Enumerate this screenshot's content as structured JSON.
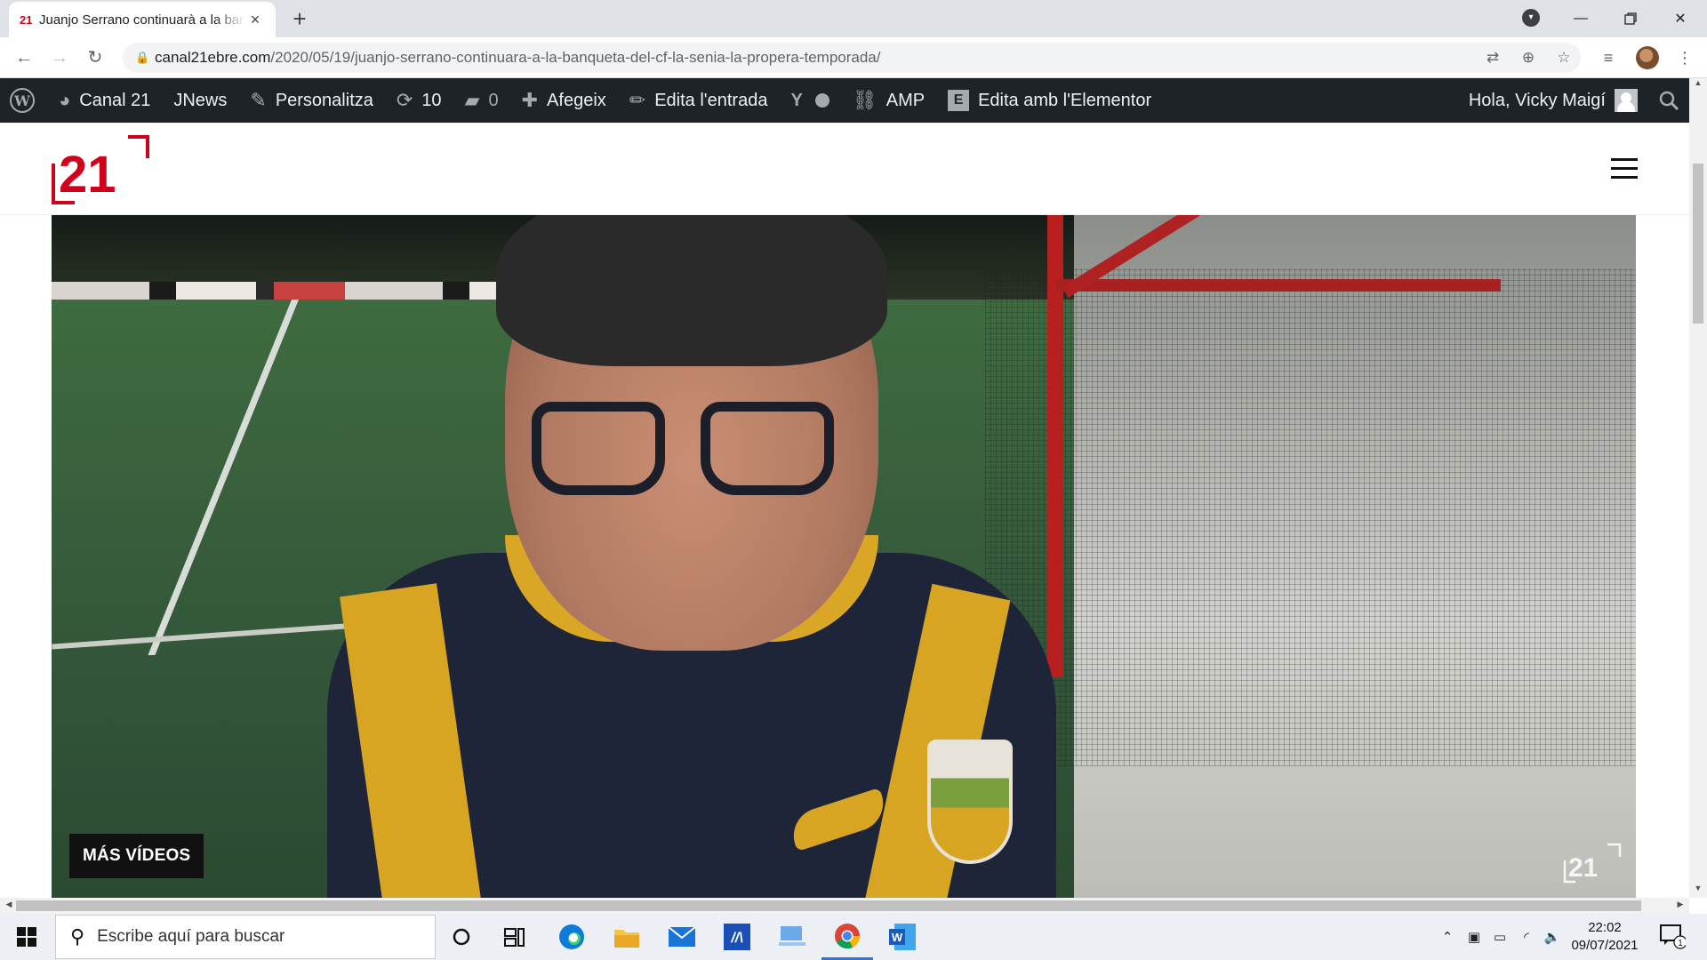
{
  "browser": {
    "tab": {
      "favicon": "21",
      "title": "Juanjo Serrano continuarà a la banqueta del CF La Sénia la propera temporada",
      "close_icon": "×"
    },
    "new_tab_icon": "+",
    "url_host": "canal21ebre.com",
    "url_path": "/2020/05/19/juanjo-serrano-continuara-a-la-banqueta-del-cf-la-senia-la-propera-temporada/"
  },
  "wp_admin_bar": {
    "site_name": "Canal 21",
    "jnews": "JNews",
    "customize": "Personalitza",
    "updates_count": "10",
    "comments_count": "0",
    "add_new": "Afegeix",
    "edit_post": "Edita l'entrada",
    "amp": "AMP",
    "elementor": "Edita amb l'Elementor",
    "greeting": "Hola, Vicky Maigí"
  },
  "site": {
    "logo_text": "21",
    "brand_color": "#d0021b"
  },
  "video": {
    "more_videos": "MÁS VÍDEOS",
    "watermark": "21"
  },
  "taskbar": {
    "search_placeholder": "Escribe aquí para buscar",
    "time": "22:02",
    "date": "09/07/2021",
    "notification_count": "1",
    "apps": [
      "cortana-icon",
      "task-view-icon",
      "edge-icon",
      "file-explorer-icon",
      "mail-icon",
      "app-icon",
      "desktop-icon",
      "chrome-icon",
      "word-icon"
    ]
  }
}
